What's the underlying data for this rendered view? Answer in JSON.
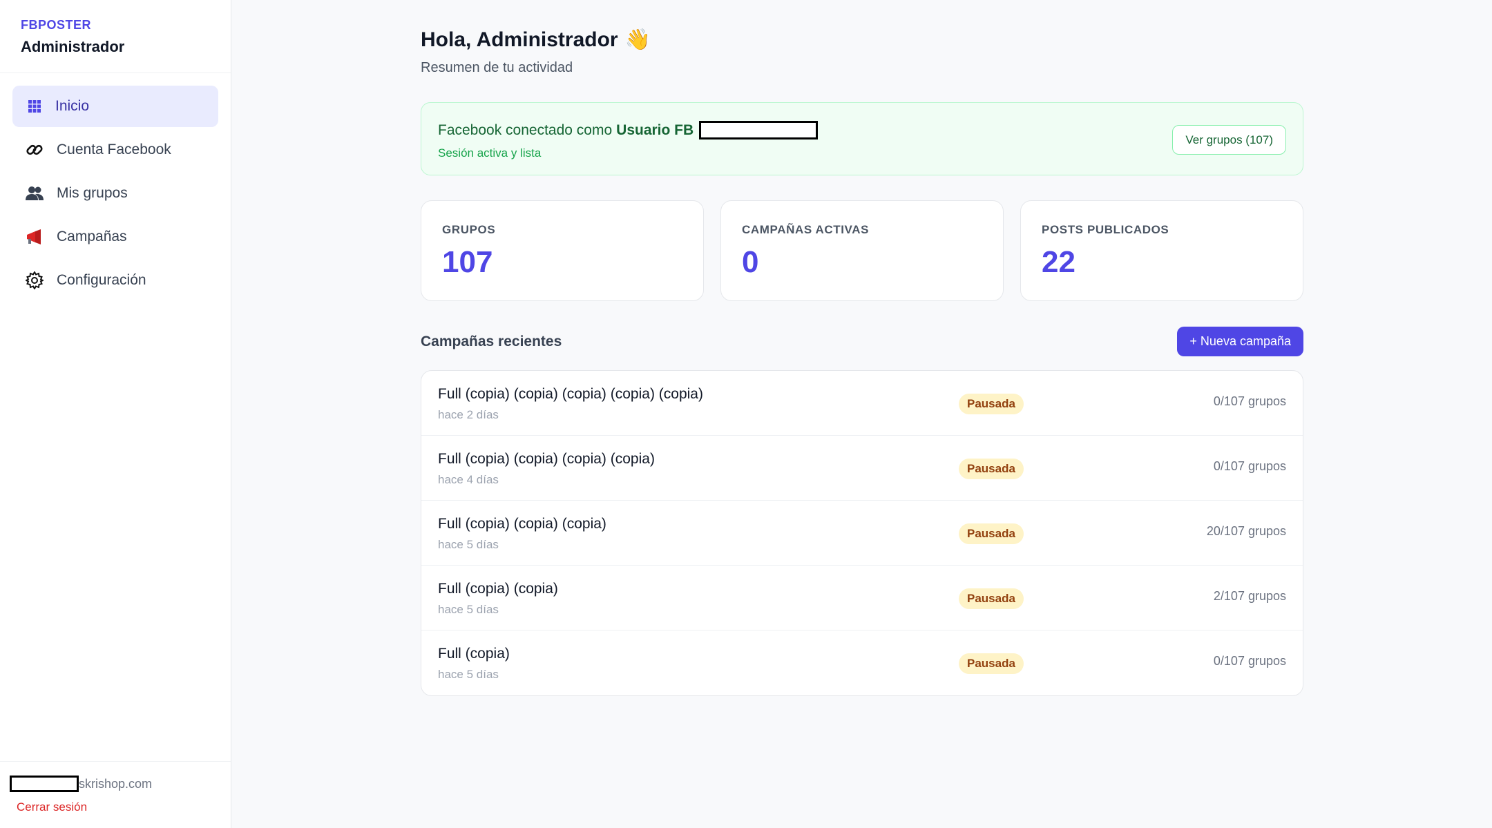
{
  "sidebar": {
    "brand_small": "FBPOSTER",
    "brand_title": "Administrador",
    "items": [
      {
        "label": "Inicio",
        "icon": "grid-icon",
        "active": true
      },
      {
        "label": "Cuenta Facebook",
        "icon": "link-icon"
      },
      {
        "label": "Mis grupos",
        "icon": "users-icon"
      },
      {
        "label": "Campañas",
        "icon": "megaphone-icon"
      },
      {
        "label": "Configuración",
        "icon": "gear-icon"
      }
    ],
    "footer_email_suffix": "skrishop.com",
    "logout": "Cerrar sesión"
  },
  "header": {
    "greeting": "Hola, Administrador",
    "wave": "👋",
    "subtitle": "Resumen de tu actividad"
  },
  "facebook": {
    "prefix": "Facebook conectado como",
    "user": "Usuario FB",
    "status": "Sesión activa y lista",
    "button": "Ver grupos (107)"
  },
  "stats": [
    {
      "label": "GRUPOS",
      "value": "107"
    },
    {
      "label": "CAMPAÑAS ACTIVAS",
      "value": "0"
    },
    {
      "label": "POSTS PUBLICADOS",
      "value": "22"
    }
  ],
  "recent": {
    "title": "Campañas recientes",
    "new_button": "+ Nueva campaña",
    "items": [
      {
        "name": "Full (copia) (copia) (copia) (copia) (copia)",
        "date": "hace 2 días",
        "status": "Pausada",
        "groups": "0/107 grupos"
      },
      {
        "name": "Full (copia) (copia) (copia) (copia)",
        "date": "hace 4 días",
        "status": "Pausada",
        "groups": "0/107 grupos"
      },
      {
        "name": "Full (copia) (copia) (copia)",
        "date": "hace 5 días",
        "status": "Pausada",
        "groups": "20/107 grupos"
      },
      {
        "name": "Full (copia) (copia)",
        "date": "hace 5 días",
        "status": "Pausada",
        "groups": "2/107 grupos"
      },
      {
        "name": "Full (copia)",
        "date": "hace 5 días",
        "status": "Pausada",
        "groups": "0/107 grupos"
      }
    ]
  },
  "colors": {
    "accent": "#4f46e5",
    "success": "#166534",
    "warning_bg": "#fef3c7",
    "danger": "#dc2626"
  }
}
